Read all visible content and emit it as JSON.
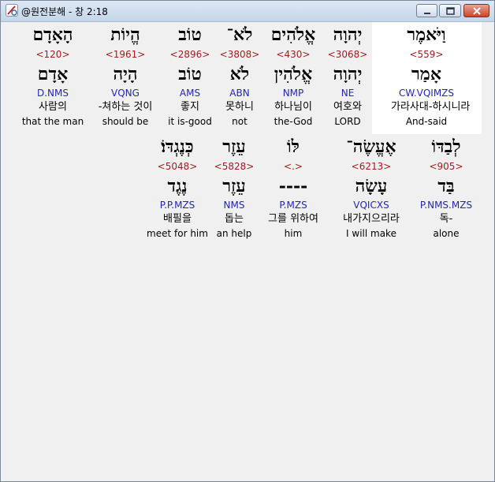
{
  "window": {
    "title": "@원전분해 - 창 2:18"
  },
  "colors": {
    "strong": "#9a1c1c",
    "morph": "#2424b8",
    "highlight_bg": "#ffffff"
  },
  "rows": [
    [
      {
        "hebrew": "וַיֹּאמֶר",
        "strong": "<559>",
        "lemma": "אָמַר",
        "morph": "CW.VQIMZS",
        "korean": "가라사대-하시니라",
        "english": "And-said",
        "highlighted": true
      },
      {
        "hebrew": "יְהוָה",
        "strong": "<3068>",
        "lemma": "יְהוָה",
        "morph": "NE",
        "korean": "여호와",
        "english": "LORD"
      },
      {
        "hebrew": "אֱלֹהִים",
        "strong": "<430>",
        "lemma": "אֱלֹהִין",
        "morph": "NMP",
        "korean": "하나님이",
        "english": "the-God"
      },
      {
        "hebrew": "לֹא־",
        "strong": "<3808>",
        "lemma": "לֹא",
        "morph": "ABN",
        "korean": "못하니",
        "english": "not"
      },
      {
        "hebrew": "טוֹב",
        "strong": "<2896>",
        "lemma": "טוֹב",
        "morph": "AMS",
        "korean": "좋지",
        "english": "it is-good"
      },
      {
        "hebrew": "הֱיוֹת",
        "strong": "<1961>",
        "lemma": "הָיָה",
        "morph": "VQNG",
        "korean": "-쳐하는 것이",
        "english": "should be"
      },
      {
        "hebrew": "הָאָדָם",
        "strong": "<120>",
        "lemma": "אָדָם",
        "morph": "D.NMS",
        "korean": "사람의",
        "english": "that the man"
      }
    ],
    [
      {
        "hebrew": "לְבַדּוֹ",
        "strong": "<905>",
        "lemma": "בַּד",
        "morph": "P.NMS.MZS",
        "korean": "독-",
        "english": "alone"
      },
      {
        "hebrew": "אֶעֱשֶׂה־",
        "strong": "<6213>",
        "lemma": "עָשָׂה",
        "morph": "VQICXS",
        "korean": "내가지으리라",
        "english": "I will make"
      },
      {
        "hebrew": "לּוֹ",
        "strong": "<.>",
        "lemma": "----",
        "morph": "P.MZS",
        "korean": "그를 위하여",
        "english": "him"
      },
      {
        "hebrew": "עֵזֶר",
        "strong": "<5828>",
        "lemma": "עֵזֶר",
        "morph": "NMS",
        "korean": "돕는",
        "english": "an help"
      },
      {
        "hebrew": "כְּנֶגְדּוֹ׃",
        "strong": "<5048>",
        "lemma": "נֶגֶד",
        "morph": "P.P.MZS",
        "korean": "배필을",
        "english": "meet for him"
      }
    ]
  ]
}
